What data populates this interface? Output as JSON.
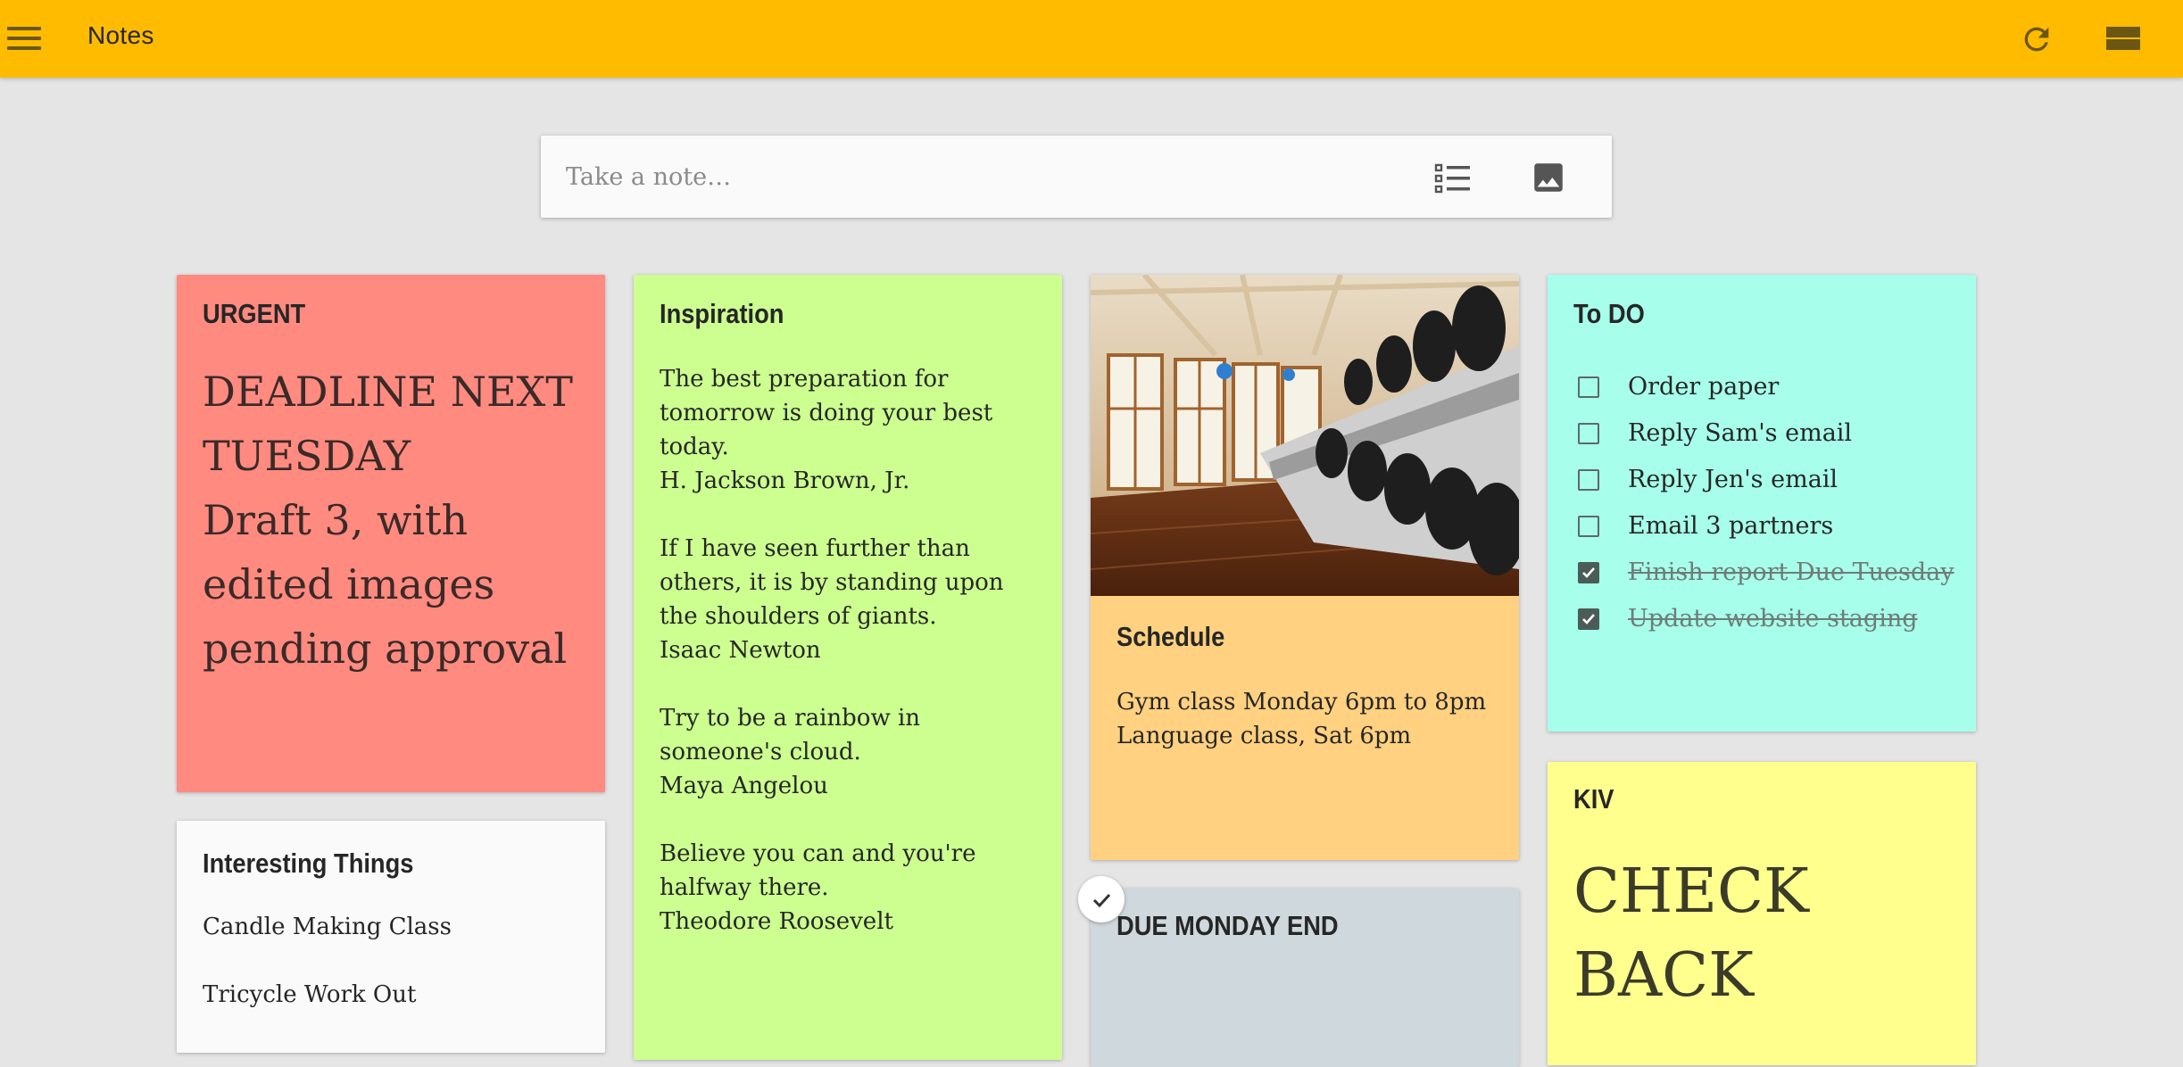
{
  "app": {
    "title": "Notes",
    "bar_color": "#ffbb00",
    "icons": {
      "menu": "hamburger-menu-icon",
      "refresh": "refresh-icon",
      "layout": "view-stream-icon"
    }
  },
  "composer": {
    "placeholder": "Take a note…",
    "value": "",
    "icons": {
      "list": "checklist-icon",
      "image": "image-icon"
    }
  },
  "notes": {
    "urgent": {
      "title": "URGENT",
      "color": "#ff8a80",
      "lines": [
        "DEADLINE NEXT",
        "TUESDAY",
        "Draft 3, with",
        "edited images",
        "pending approval"
      ]
    },
    "interesting": {
      "title": "Interesting Things",
      "color": "#fafafa",
      "items": [
        "Candle Making Class",
        "Tricycle Work Out"
      ]
    },
    "inspiration": {
      "title": "Inspiration",
      "color": "#ccff90",
      "lines": [
        "The best preparation for",
        "tomorrow is doing your best",
        "today.",
        "H. Jackson Brown, Jr.",
        "",
        "If I have seen further than",
        "others, it is by standing upon",
        "the shoulders of giants.",
        "Isaac Newton",
        "",
        "Try to be a rainbow in",
        "someone's cloud.",
        "Maya Angelou",
        "",
        "Believe you can and you're",
        "halfway there.",
        "Theodore Roosevelt"
      ]
    },
    "schedule": {
      "title": "Schedule",
      "color": "#ffd180",
      "lines": [
        "Gym class Monday 6pm to 8pm",
        "Language class, Sat 6pm"
      ]
    },
    "due": {
      "title": "DUE MONDAY END",
      "color": "#cfd8dc"
    },
    "todo": {
      "title": "To DO",
      "color": "#a7ffeb",
      "items": [
        {
          "label": "Order paper",
          "checked": false
        },
        {
          "label": "Reply Sam's email",
          "checked": false
        },
        {
          "label": "Reply Jen's email",
          "checked": false
        },
        {
          "label": "Email 3 partners",
          "checked": false
        },
        {
          "label": "Finish report Due Tuesday",
          "checked": true
        },
        {
          "label": "Update website staging ",
          "checked": true
        }
      ]
    },
    "kiv": {
      "title": "KIV",
      "color": "#ffff8d",
      "lines": [
        "CHECK",
        "BACK"
      ]
    }
  }
}
